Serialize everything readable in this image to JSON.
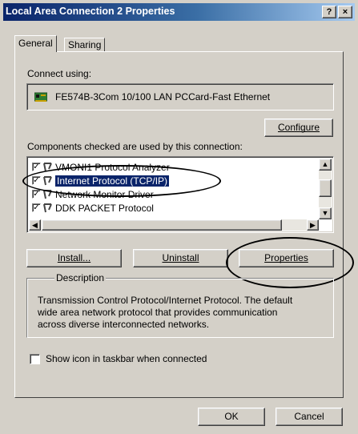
{
  "window": {
    "title": "Local Area Connection 2 Properties",
    "help_label": "?",
    "close_label": "×"
  },
  "tabs": [
    {
      "label": "General"
    },
    {
      "label": "Sharing"
    }
  ],
  "connect": {
    "label": "Connect using:",
    "adapter": "FE574B-3Com 10/100 LAN PCCard-Fast Ethernet",
    "configure_button": "Configure"
  },
  "components": {
    "label": "Components checked are used by this connection:",
    "items": [
      {
        "name": "VMONI1 Protocol Analyzer",
        "checked": true,
        "selected": false
      },
      {
        "name": "Internet Protocol (TCP/IP)",
        "checked": true,
        "selected": true
      },
      {
        "name": "Network Monitor Driver",
        "checked": true,
        "selected": false
      },
      {
        "name": "DDK PACKET Protocol",
        "checked": true,
        "selected": false
      }
    ]
  },
  "buttons": {
    "install": "Install...",
    "uninstall": "Uninstall",
    "properties": "Properties",
    "ok": "OK",
    "cancel": "Cancel"
  },
  "description": {
    "legend": "Description",
    "line1": "Transmission Control Protocol/Internet Protocol. The default",
    "line2": "wide area network protocol that provides communication",
    "line3": "across diverse interconnected networks."
  },
  "taskbar_option": {
    "label": "Show icon in taskbar when connected",
    "checked": false
  },
  "colors": {
    "title_gradient_start": "#0a246a",
    "title_gradient_end": "#a6caf0",
    "face": "#d4d0c8",
    "selection": "#0a246a"
  }
}
